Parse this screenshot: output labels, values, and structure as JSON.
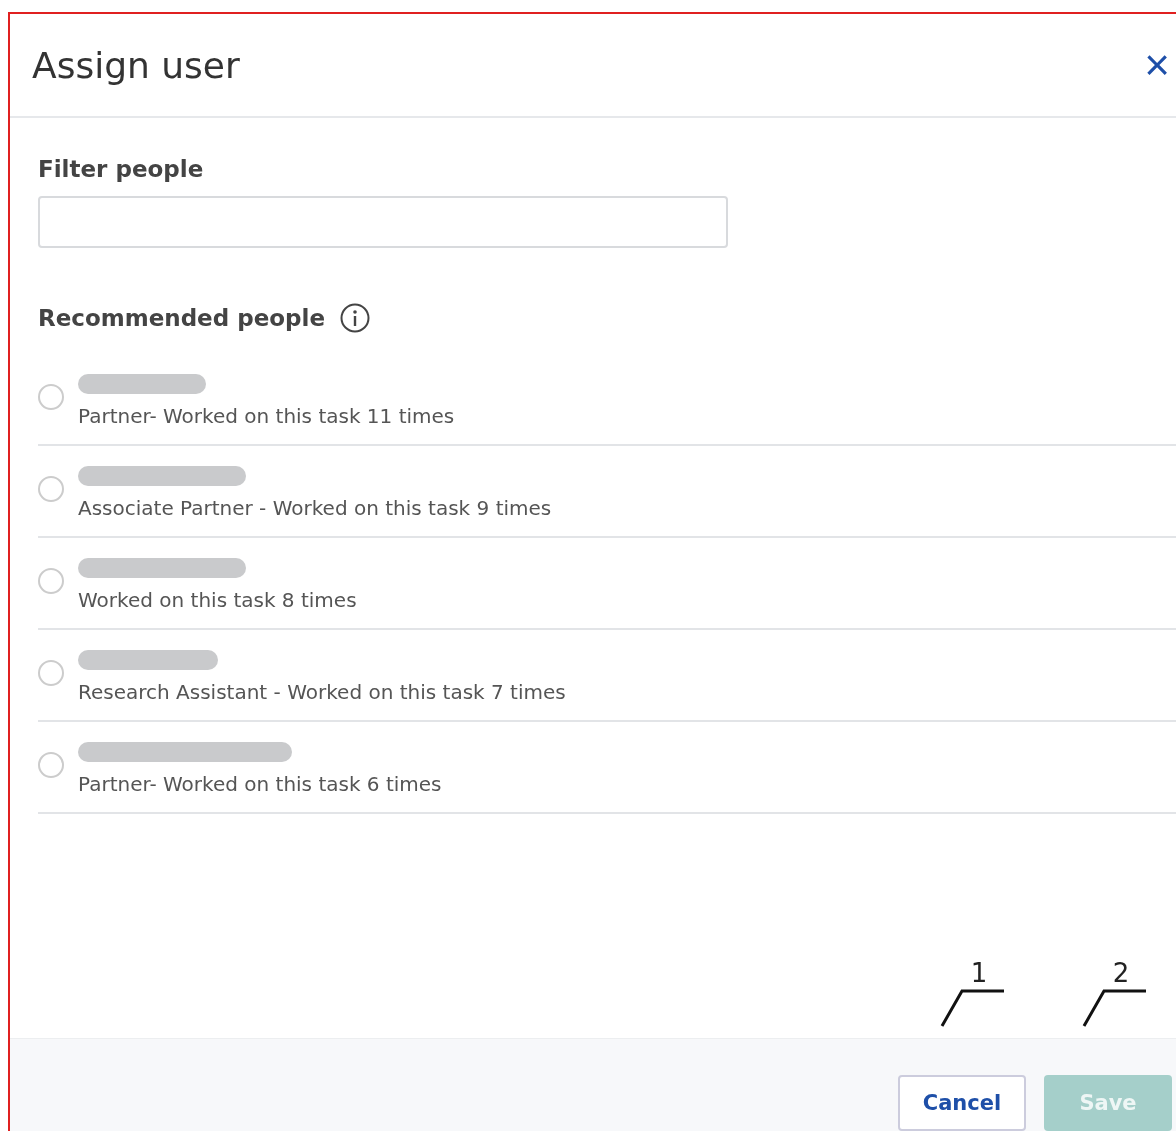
{
  "dialog": {
    "title": "Assign user",
    "close": "×"
  },
  "filter": {
    "label": "Filter people"
  },
  "recommended": {
    "heading": "Recommended people",
    "people": [
      {
        "selected": false,
        "detail": "Partner- Worked on this task 11 times"
      },
      {
        "selected": false,
        "detail": "Associate Partner - Worked on this task 9 times"
      },
      {
        "selected": false,
        "detail": "Worked on this task 8 times"
      },
      {
        "selected": false,
        "detail": "Research Assistant - Worked on this task 7 times"
      },
      {
        "selected": false,
        "detail": "Partner- Worked on this task 6 times"
      }
    ]
  },
  "annotations": [
    "1",
    "2"
  ],
  "buttons": [
    {
      "kind": "secondary",
      "label": "Cancel",
      "disabled": false
    },
    {
      "kind": "primary",
      "label": "Save",
      "disabled": true
    }
  ]
}
